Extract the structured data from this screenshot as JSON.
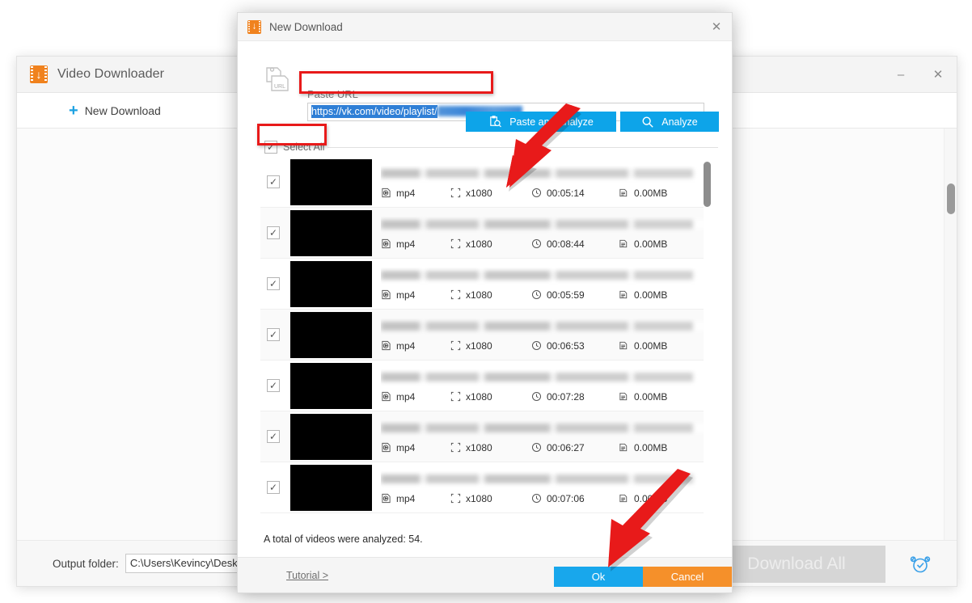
{
  "app": {
    "title": "Video Downloader",
    "logo_icon": "app-download-icon",
    "toolbar": {
      "new_download_label": "New Download",
      "plus_icon": "plus-icon"
    },
    "window_controls": {
      "minimize": "–",
      "close": "✕"
    },
    "footer": {
      "output_folder_label": "Output folder:",
      "output_folder_value": "C:\\Users\\Kevincy\\Desktop\\Out",
      "download_all_label": "Download All",
      "alarm_icon": "alarm-clock-icon"
    }
  },
  "modal": {
    "title": "New Download",
    "logo_icon": "app-download-icon",
    "close_icon": "close-icon",
    "url": {
      "label": "Paste URL",
      "icon": "paste-url-icon",
      "value": "https://vk.com/video/playlist/",
      "redacted": true
    },
    "buttons": {
      "paste_and_analyze": "Paste and Analyze",
      "paste_icon": "clipboard-search-icon",
      "analyze": "Analyze",
      "analyze_icon": "magnifier-icon"
    },
    "select_all": {
      "label": "Select All",
      "checked": true,
      "check_icon": "check-icon"
    },
    "columns": {
      "format": "mp4",
      "resolution": "x1080",
      "size": "0.00MB"
    },
    "icons": {
      "format": "video-file-icon",
      "resolution": "resolution-icon",
      "duration": "clock-icon",
      "size": "file-size-icon"
    },
    "rows": [
      {
        "checked": true,
        "format": "mp4",
        "resolution": "x1080",
        "duration": "00:05:14",
        "size": "0.00MB"
      },
      {
        "checked": true,
        "format": "mp4",
        "resolution": "x1080",
        "duration": "00:08:44",
        "size": "0.00MB"
      },
      {
        "checked": true,
        "format": "mp4",
        "resolution": "x1080",
        "duration": "00:05:59",
        "size": "0.00MB"
      },
      {
        "checked": true,
        "format": "mp4",
        "resolution": "x1080",
        "duration": "00:06:53",
        "size": "0.00MB"
      },
      {
        "checked": true,
        "format": "mp4",
        "resolution": "x1080",
        "duration": "00:07:28",
        "size": "0.00MB"
      },
      {
        "checked": true,
        "format": "mp4",
        "resolution": "x1080",
        "duration": "00:06:27",
        "size": "0.00MB"
      },
      {
        "checked": true,
        "format": "mp4",
        "resolution": "x1080",
        "duration": "00:07:06",
        "size": "0.00MB"
      }
    ],
    "total_text": "A total of videos were analyzed: 54.",
    "footer": {
      "tutorial": "Tutorial >",
      "ok": "Ok",
      "cancel": "Cancel"
    }
  },
  "annotations": {
    "highlight_color": "#e81a1a",
    "boxes": [
      "url-input-highlight",
      "select-all-highlight"
    ],
    "arrows": [
      "arrow-to-paste-and-analyze",
      "arrow-to-ok-button"
    ]
  },
  "colors": {
    "accent_blue": "#0da4e9",
    "accent_orange": "#f5902a",
    "brand_orange": "#f0821e",
    "annotation_red": "#e81a1a"
  }
}
